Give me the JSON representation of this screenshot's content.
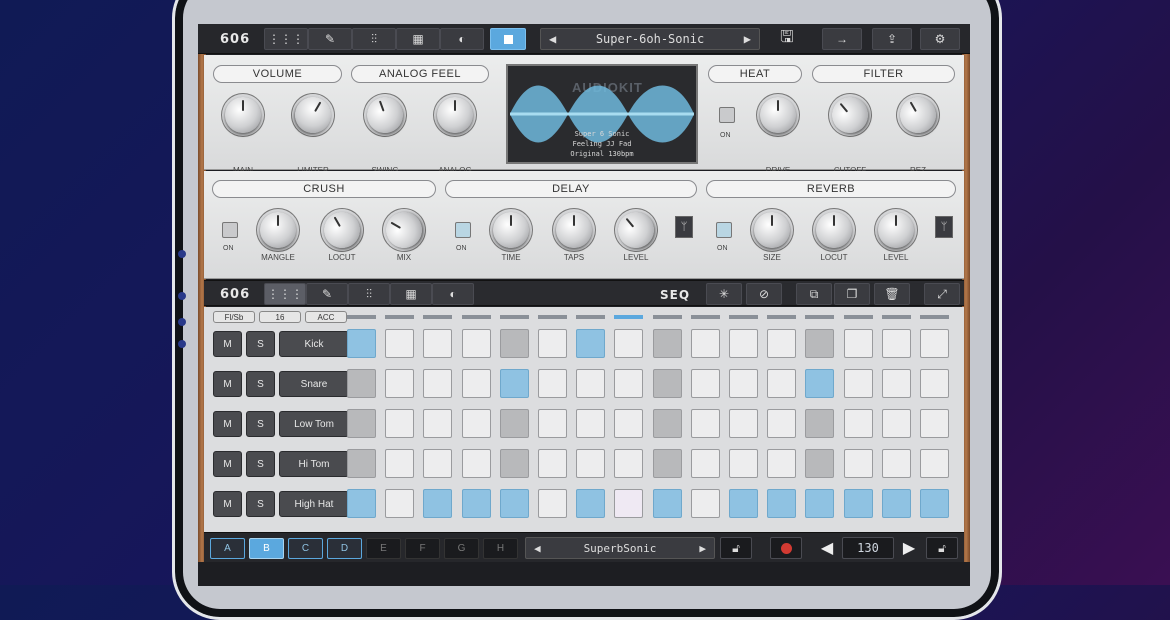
{
  "app": {
    "logo": "606"
  },
  "topbar": {
    "preset_name": "Super-6oh-Sonic",
    "prev": "◀",
    "next": "▶",
    "save_icon": "save-icon",
    "forward_icon": "arrow-right-icon",
    "share_icon": "share-icon",
    "settings_icon": "gear-icon"
  },
  "fx": {
    "sections": {
      "volume": "VOLUME",
      "analog_feel": "ANALOG FEEL",
      "heat": "HEAT",
      "filter": "FILTER",
      "crush": "CRUSH",
      "delay": "DELAY",
      "reverb": "REVERB"
    },
    "knobs": {
      "main": "MAIN",
      "limiter": "LIMITER",
      "swing": "SWING",
      "analog": "ANALOG",
      "drive": "DRIVE",
      "cutoff": "CUTOFF",
      "rez": "REZ",
      "mangle": "MANGLE",
      "locut": "LOCUT",
      "mix": "MIX",
      "time": "TIME",
      "taps": "TAPS",
      "level": "LEVEL",
      "size": "SIZE"
    },
    "on_label": "ON"
  },
  "display": {
    "brand": "AUDIOKIT",
    "line1": "Super 6 Sonic",
    "line2": "Feeling JJ Fad",
    "line3": "Original 130bpm"
  },
  "sequencer": {
    "logo": "606",
    "seq_label": "SEQ",
    "header_buttons": [
      "Fl/Sb",
      "16",
      "ACC"
    ],
    "step_indicators": [
      0,
      0,
      0,
      0,
      0,
      0,
      0,
      1,
      0,
      0,
      0,
      0,
      0,
      0,
      0,
      0
    ],
    "mute": "M",
    "solo": "S",
    "rows": [
      {
        "name": "Kick",
        "steps": [
          "b",
          "w",
          "w",
          "w",
          "g",
          "w",
          "b",
          "w",
          "g",
          "w",
          "w",
          "w",
          "g",
          "w",
          "w",
          "w"
        ]
      },
      {
        "name": "Snare",
        "steps": [
          "g",
          "w",
          "w",
          "w",
          "b",
          "w",
          "w",
          "w",
          "g",
          "w",
          "w",
          "w",
          "b",
          "w",
          "w",
          "w"
        ]
      },
      {
        "name": "Low Tom",
        "steps": [
          "g",
          "w",
          "w",
          "w",
          "g",
          "w",
          "w",
          "w",
          "g",
          "w",
          "w",
          "w",
          "g",
          "w",
          "w",
          "w"
        ]
      },
      {
        "name": "Hi Tom",
        "steps": [
          "g",
          "w",
          "w",
          "w",
          "g",
          "w",
          "w",
          "w",
          "g",
          "w",
          "w",
          "w",
          "g",
          "w",
          "w",
          "w"
        ]
      },
      {
        "name": "High Hat",
        "steps": [
          "b",
          "w",
          "b",
          "b",
          "b",
          "w",
          "b",
          "p",
          "b",
          "w",
          "b",
          "b",
          "b",
          "b",
          "b",
          "b"
        ]
      }
    ]
  },
  "bottom": {
    "patterns": [
      "A",
      "B",
      "C",
      "D",
      "E",
      "F",
      "G",
      "H"
    ],
    "active_patterns": [
      "A",
      "B",
      "C",
      "D"
    ],
    "current_pattern": "B",
    "pattern_name": "SuperbSonic",
    "tempo": "130",
    "prev": "◀",
    "next": "▶"
  },
  "colors": {
    "accent": "#5ba8de",
    "step_on": "#8fc2e2",
    "step_accent": "#b8b9bb"
  }
}
